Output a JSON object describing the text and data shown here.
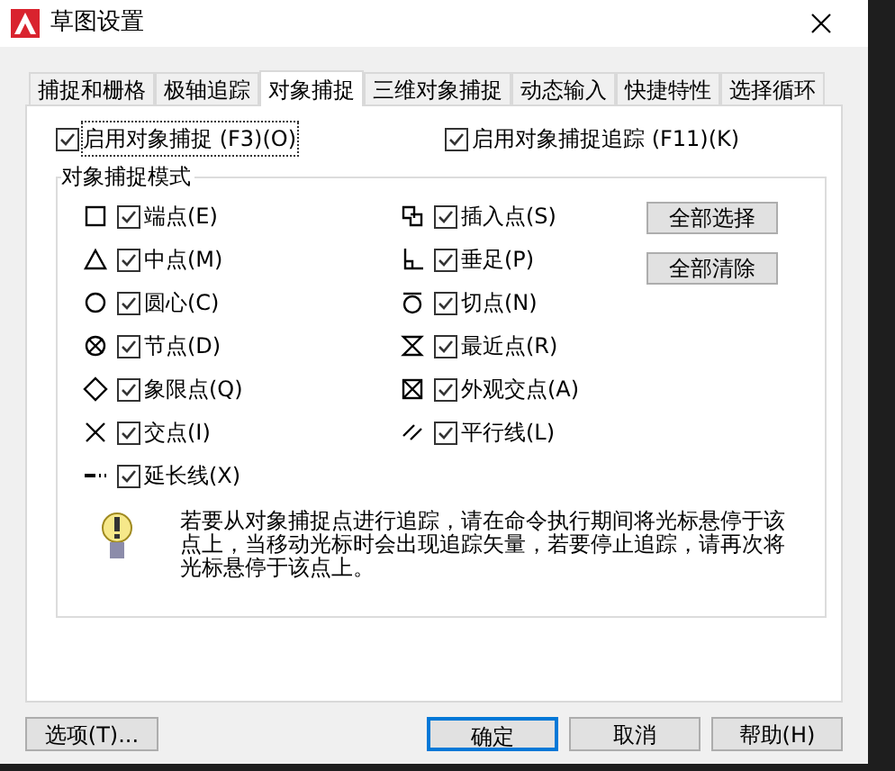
{
  "window": {
    "title": "草图设置"
  },
  "tabs": [
    {
      "label": "捕捉和栅格",
      "selected": false
    },
    {
      "label": "极轴追踪",
      "selected": false
    },
    {
      "label": "对象捕捉",
      "selected": true
    },
    {
      "label": "三维对象捕捉",
      "selected": false
    },
    {
      "label": "动态输入",
      "selected": false
    },
    {
      "label": "快捷特性",
      "selected": false
    },
    {
      "label": "选择循环",
      "selected": false
    }
  ],
  "enable_snap": {
    "label": "启用对象捕捉 (F3)(O)",
    "checked": true
  },
  "enable_tracking": {
    "label": "启用对象捕捉追踪 (F11)(K)",
    "checked": true
  },
  "modes_group": {
    "title": "对象捕捉模式",
    "left": [
      {
        "label": "端点(E)",
        "checked": true
      },
      {
        "label": "中点(M)",
        "checked": true
      },
      {
        "label": "圆心(C)",
        "checked": true
      },
      {
        "label": "节点(D)",
        "checked": true
      },
      {
        "label": "象限点(Q)",
        "checked": true
      },
      {
        "label": "交点(I)",
        "checked": true
      },
      {
        "label": "延长线(X)",
        "checked": true
      }
    ],
    "right": [
      {
        "label": "插入点(S)",
        "checked": true
      },
      {
        "label": "垂足(P)",
        "checked": true
      },
      {
        "label": "切点(N)",
        "checked": true
      },
      {
        "label": "最近点(R)",
        "checked": true
      },
      {
        "label": "外观交点(A)",
        "checked": true
      },
      {
        "label": "平行线(L)",
        "checked": true
      }
    ],
    "buttons": [
      "全部选择",
      "全部清除"
    ]
  },
  "hint": "若要从对象捕捉点进行追踪，请在命令执行期间将光标悬停于该点上，当移动光标时会出现追踪矢量，若要停止追踪，请再次将光标悬停于该点上。",
  "footer": {
    "options_button": "选项(T)...",
    "buttons": [
      {
        "label": "确定",
        "selected": true
      },
      {
        "label": "取消",
        "selected": false
      },
      {
        "label": "帮助(H)",
        "selected": false
      }
    ]
  }
}
